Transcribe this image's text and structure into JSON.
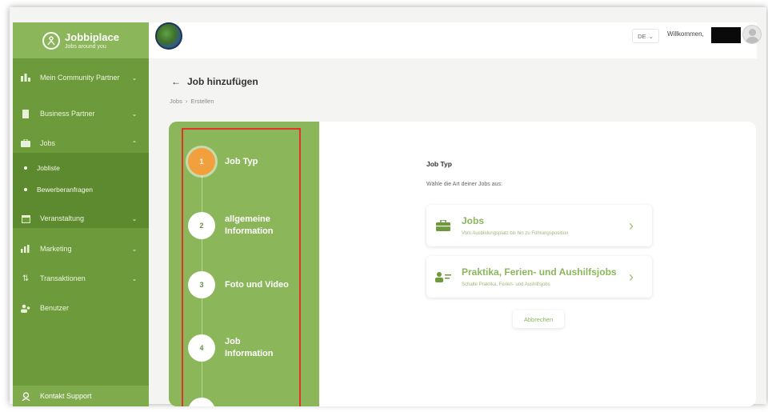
{
  "brand": {
    "title": "Jobbiplace",
    "subtitle": "Jobs around you"
  },
  "header": {
    "language": "DE",
    "welcome": "Willkommen,"
  },
  "sidebar": {
    "items": [
      {
        "label": "Mein Community Partner",
        "icon": "community-icon",
        "chevron": "chevron-down"
      },
      {
        "label": "Business Partner",
        "icon": "building-icon",
        "chevron": "chevron-down"
      },
      {
        "label": "Jobs",
        "icon": "briefcase-icon",
        "chevron": "chevron-up"
      },
      {
        "label": "Veranstaltung",
        "icon": "calendar-icon",
        "chevron": "chevron-down"
      },
      {
        "label": "Marketing",
        "icon": "chart-icon",
        "chevron": "chevron-down"
      },
      {
        "label": "Transaktionen",
        "icon": "transfer-icon",
        "chevron": "chevron-down"
      },
      {
        "label": "Benutzer",
        "icon": "users-icon",
        "chevron": ""
      }
    ],
    "sub_items": [
      {
        "label": "Jobliste"
      },
      {
        "label": "Bewerberanfragen"
      }
    ],
    "support": {
      "label": "Kontakt Support"
    }
  },
  "page": {
    "title": "Job hinzufügen",
    "breadcrumb": [
      "Jobs",
      "Erstellen"
    ]
  },
  "stepper": {
    "steps": [
      {
        "number": "1",
        "label": "Job Typ",
        "active": true
      },
      {
        "number": "2",
        "label": "allgemeine Information",
        "active": false
      },
      {
        "number": "3",
        "label": "Foto und Video",
        "active": false
      },
      {
        "number": "4",
        "label": "Job Information",
        "active": false
      }
    ]
  },
  "content": {
    "title": "Job Typ",
    "subtitle": "Wähle die Art deiner Jobs aus:",
    "options": [
      {
        "title": "Jobs",
        "description": "Vom Ausbildungsplatz bis hin zu Führungsposition",
        "icon": "briefcase-icon"
      },
      {
        "title": "Praktika, Ferien- und Aushilfsjobs",
        "description": "Schalte Praktika, Ferien- und Aushilfsjobs",
        "icon": "person-card-icon"
      }
    ],
    "cancel_label": "Abbrechen"
  },
  "colors": {
    "sidebar": "#6d9a3a",
    "stepper": "#8bb75a",
    "active_step": "#f2a03d",
    "highlight_border": "#e0342d"
  }
}
